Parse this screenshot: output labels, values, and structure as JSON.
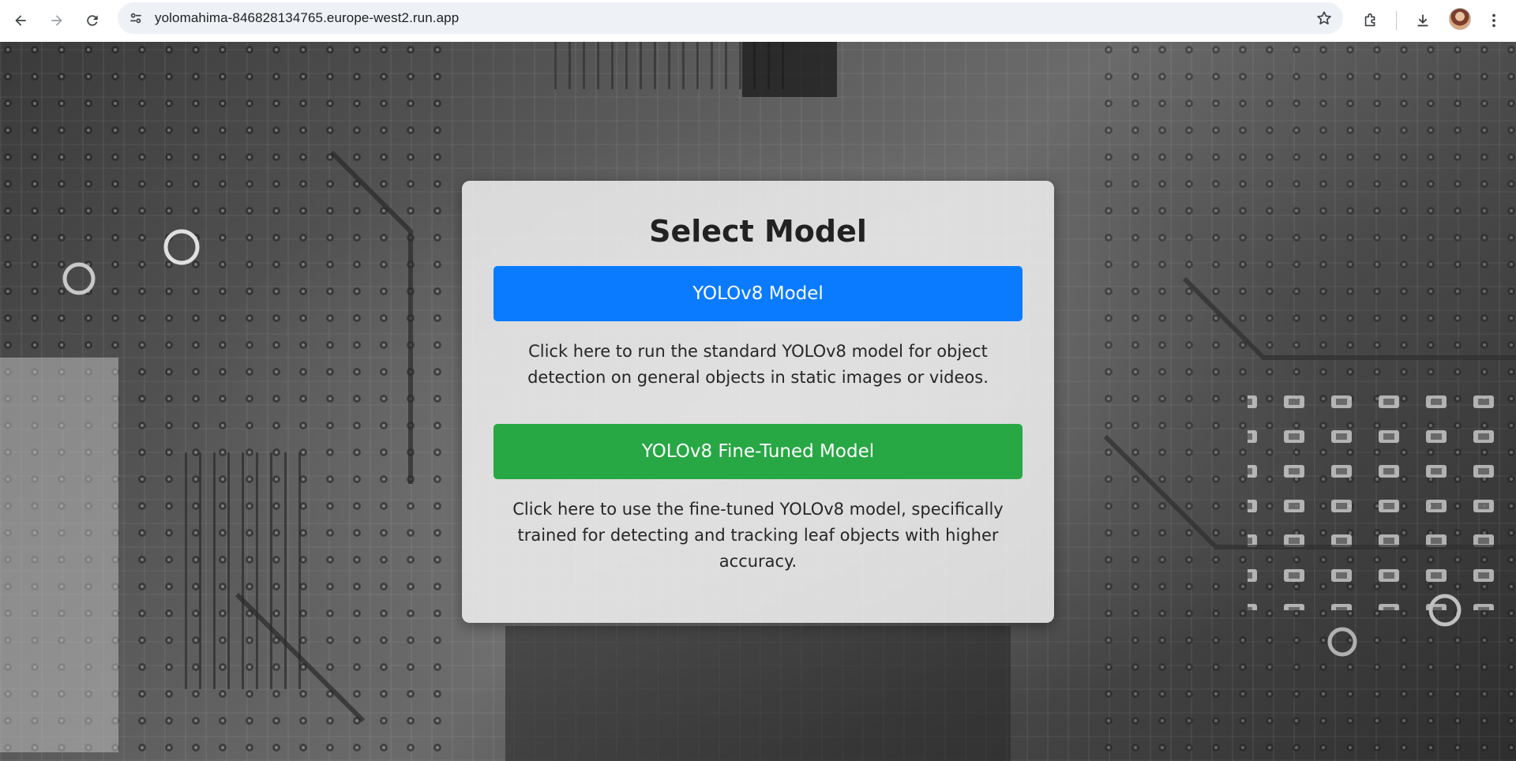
{
  "browser": {
    "url": "yolomahima-846828134765.europe-west2.run.app",
    "icons": {
      "back": "arrow-left-icon",
      "forward": "arrow-right-icon",
      "reload": "reload-icon",
      "site_info": "tune-icon",
      "bookmark": "star-icon",
      "extensions": "puzzle-icon",
      "downloads": "download-icon",
      "menu": "kebab-menu-icon"
    }
  },
  "page": {
    "title": "Select Model",
    "models": [
      {
        "label": "YOLOv8 Model",
        "description": "Click here to run the standard YOLOv8 model for object detection on general objects in static images or videos.",
        "color": "#0a7bff"
      },
      {
        "label": "YOLOv8 Fine-Tuned Model",
        "description": "Click here to use the fine-tuned YOLOv8 model, specifically trained for detecting and tracking leaf objects with higher accuracy.",
        "color": "#28a745"
      }
    ]
  }
}
